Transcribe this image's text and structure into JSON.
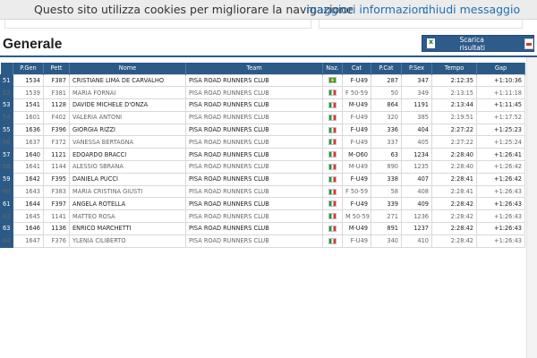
{
  "cookie_bar": {
    "message": "Questo sito utilizza cookies per migliorare la navigazione",
    "more_info_link": "maggiori informazioni",
    "close_link": "chiudi messaggio"
  },
  "section": {
    "title": "Generale",
    "download_button": "Scarica risultati"
  },
  "table": {
    "columns": [
      "P.Gen",
      "Pett",
      "Nome",
      "Team",
      "Naz.",
      "Cat",
      "P.Cat",
      "P.Sex",
      "Tempo",
      "Gap"
    ],
    "rows": [
      {
        "idx": "51",
        "pgen": "1534",
        "pett": "F387",
        "nome": "CRISTIANE LIMA DE CARVALHO",
        "team": "PISA ROAD RUNNERS CLUB",
        "naz": "br",
        "cat": "F-U49",
        "pcat": "287",
        "psex": "347",
        "tempo": "2:12:35",
        "gap": "+1:10:36"
      },
      {
        "idx": "52",
        "pgen": "1539",
        "pett": "F381",
        "nome": "MARIA FORNAI",
        "team": "PISA ROAD RUNNERS CLUB",
        "naz": "it",
        "cat": "F 50-59",
        "pcat": "50",
        "psex": "349",
        "tempo": "2:13:15",
        "gap": "+1:11:18"
      },
      {
        "idx": "53",
        "pgen": "1541",
        "pett": "1128",
        "nome": "DAVIDE MICHELE D'ONZA",
        "team": "PISA ROAD RUNNERS CLUB",
        "naz": "it",
        "cat": "M-U49",
        "pcat": "864",
        "psex": "1191",
        "tempo": "2:13:44",
        "gap": "+1:11:45"
      },
      {
        "idx": "54",
        "pgen": "1601",
        "pett": "F402",
        "nome": "VALERIA ANTONI",
        "team": "PISA ROAD RUNNERS CLUB",
        "naz": "it",
        "cat": "F-U49",
        "pcat": "320",
        "psex": "385",
        "tempo": "2:19:51",
        "gap": "+1:17:52"
      },
      {
        "idx": "55",
        "pgen": "1636",
        "pett": "F396",
        "nome": "GIORGIA RIZZI",
        "team": "PISA ROAD RUNNERS CLUB",
        "naz": "it",
        "cat": "F-U49",
        "pcat": "336",
        "psex": "404",
        "tempo": "2:27:22",
        "gap": "+1:25:23"
      },
      {
        "idx": "56",
        "pgen": "1637",
        "pett": "F372",
        "nome": "VANESSA BERTAGNA",
        "team": "PISA ROAD RUNNERS CLUB",
        "naz": "it",
        "cat": "F-U49",
        "pcat": "337",
        "psex": "405",
        "tempo": "2:27:22",
        "gap": "+1:25:24"
      },
      {
        "idx": "57",
        "pgen": "1640",
        "pett": "1121",
        "nome": "EDOARDO BRACCI",
        "team": "PISA ROAD RUNNERS CLUB",
        "naz": "it",
        "cat": "M-O60",
        "pcat": "63",
        "psex": "1234",
        "tempo": "2:28:40",
        "gap": "+1:26:41"
      },
      {
        "idx": "58",
        "pgen": "1641",
        "pett": "1144",
        "nome": "ALESSIO SBRANA",
        "team": "PISA ROAD RUNNERS CLUB",
        "naz": "it",
        "cat": "M-U49",
        "pcat": "890",
        "psex": "1235",
        "tempo": "2:28:40",
        "gap": "+1:26:42"
      },
      {
        "idx": "59",
        "pgen": "1642",
        "pett": "F395",
        "nome": "DANIELA PUCCI",
        "team": "PISA ROAD RUNNERS CLUB",
        "naz": "it",
        "cat": "F-U49",
        "pcat": "338",
        "psex": "407",
        "tempo": "2:28:41",
        "gap": "+1:26:42"
      },
      {
        "idx": "60",
        "pgen": "1643",
        "pett": "F383",
        "nome": "MARIA CRISTINA GIUSTI",
        "team": "PISA ROAD RUNNERS CLUB",
        "naz": "it",
        "cat": "F 50-59",
        "pcat": "58",
        "psex": "408",
        "tempo": "2:28:41",
        "gap": "+1:26:43"
      },
      {
        "idx": "61",
        "pgen": "1644",
        "pett": "F397",
        "nome": "ANGELA ROTELLA",
        "team": "PISA ROAD RUNNERS CLUB",
        "naz": "it",
        "cat": "F-U49",
        "pcat": "339",
        "psex": "409",
        "tempo": "2:28:42",
        "gap": "+1:26:43"
      },
      {
        "idx": "62",
        "pgen": "1645",
        "pett": "1141",
        "nome": "MATTEO ROSA",
        "team": "PISA ROAD RUNNERS CLUB",
        "naz": "it",
        "cat": "M 50-59",
        "pcat": "271",
        "psex": "1236",
        "tempo": "2:28:42",
        "gap": "+1:26:43"
      },
      {
        "idx": "63",
        "pgen": "1646",
        "pett": "1136",
        "nome": "ENRICO MARCHETTI",
        "team": "PISA ROAD RUNNERS CLUB",
        "naz": "it",
        "cat": "M-U49",
        "pcat": "891",
        "psex": "1237",
        "tempo": "2:28:42",
        "gap": "+1:26:43"
      },
      {
        "idx": "64",
        "pgen": "1647",
        "pett": "F376",
        "nome": "YLENIA CILIBERTO",
        "team": "PISA ROAD RUNNERS CLUB",
        "naz": "it",
        "cat": "F-U49",
        "pcat": "340",
        "psex": "410",
        "tempo": "2:28:42",
        "gap": "+1:26:43"
      }
    ]
  },
  "colors": {
    "header_bg": "#2c5a87",
    "link": "#1f6fb5",
    "cookie_bg": "#ececec"
  }
}
